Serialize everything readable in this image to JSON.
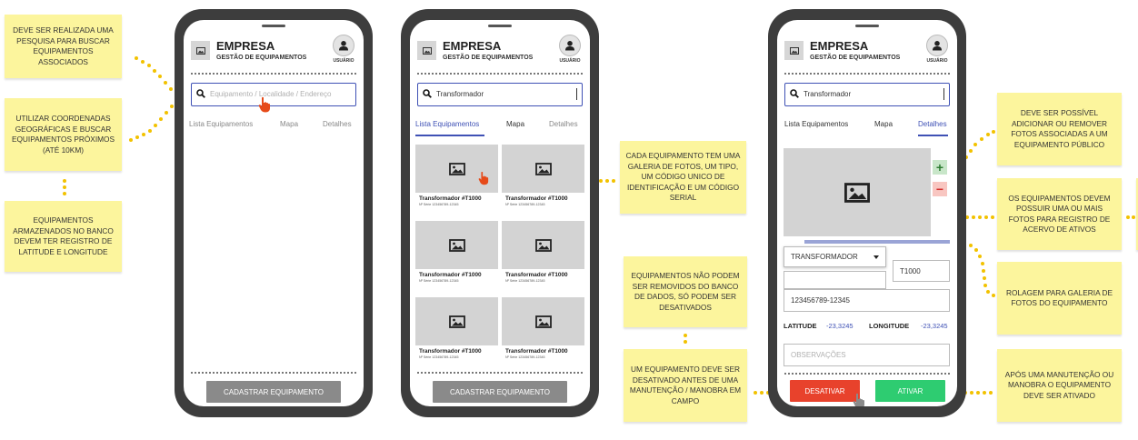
{
  "colors": {
    "note_bg": "#fcf59d",
    "connector": "#f2c200",
    "accent": "#3f51b5",
    "deactivate": "#e8422c",
    "activate": "#2ecc71",
    "cursor": "#e64a19"
  },
  "notes": {
    "n1": "DEVE SER REALIZADA UMA PESQUISA PARA BUSCAR EQUIPAMENTOS ASSOCIADOS",
    "n2": "UTILIZAR COORDENADAS GEOGRÁFICAS E BUSCAR EQUIPAMENTOS PRÓXIMOS (ATÉ 10KM)",
    "n3": "EQUIPAMENTOS ARMAZENADOS NO BANCO DEVEM TER REGISTRO DE LATITUDE E LONGITUDE",
    "n4": "CADA EQUIPAMENTO TEM UMA GALERIA DE FOTOS, UM TIPO, UM CÓDIGO UNICO DE IDENTIFICAÇÃO E UM CÓDIGO SERIAL",
    "n5": "EQUIPAMENTOS NÃO PODEM SER REMOVIDOS DO BANCO DE DADOS, SÓ PODEM SER DESATIVADOS",
    "n6": "UM EQUIPAMENTO DEVE SER DESATIVADO ANTES DE UMA MANUTENÇÃO / MANOBRA EM CAMPO",
    "n7": "DEVE SER POSSÍVEL ADICIONAR OU REMOVER FOTOS ASSOCIADAS A UM EQUIPAMENTO PÚBLICO",
    "n8": "OS EQUIPAMENTOS DEVEM POSSUIR UMA OU MAIS FOTOS PARA REGISTRO DE ACERVO DE ATIVOS",
    "n9": "ROLAGEM PARA GALERIA DE FOTOS DO EQUIPAMENTO",
    "n10": "APÓS UMA MANUTENÇÃO OU MANOBRA O EQUIPAMENTO DEVE SER ATIVADO"
  },
  "header": {
    "brand": "EMPRESA",
    "subtitle": "GESTÃO DE EQUIPAMENTOS",
    "user_label": "USUÁRIO"
  },
  "tabs": {
    "list": "Lista Equipamentos",
    "map": "Mapa",
    "details": "Detalhes"
  },
  "phone1": {
    "search_placeholder": "Equipamento / Localidade / Endereço",
    "register_button": "CADASTRAR EQUIPAMENTO"
  },
  "phone2": {
    "search_value": "Transformador",
    "cards": [
      {
        "title": "Transformador #T1000",
        "serial": "Nº Série 123456789-12345"
      },
      {
        "title": "Transformador #T1000",
        "serial": "Nº Série 123456789-12345"
      },
      {
        "title": "Transformador #T1000",
        "serial": "Nº Série 123456789-12345"
      },
      {
        "title": "Transformador #T1000",
        "serial": "Nº Série 123456789-12345"
      },
      {
        "title": "Transformador #T1000",
        "serial": "Nº Série 123456789-12345"
      },
      {
        "title": "Transformador #T1000",
        "serial": "Nº Série 123456789-12345"
      }
    ],
    "register_button": "CADASTRAR EQUIPAMENTO"
  },
  "phone3": {
    "search_value": "Transformador",
    "add_symbol": "+",
    "remove_symbol": "−",
    "type_select": "TRANSFORMADOR",
    "code_value": "T1000",
    "serial_value": "123456789-12345",
    "latitude_label": "LATITUDE",
    "latitude_value": "-23,3245",
    "longitude_label": "LONGITUDE",
    "longitude_value": "-23,3245",
    "notes_placeholder": "OBSERVAÇÕES",
    "deactivate_button": "DESATIVAR",
    "activate_button": "ATIVAR"
  },
  "icons": {
    "logo": "image-icon",
    "user": "user-icon",
    "search": "search-icon",
    "photo": "image-icon",
    "dropdown": "caret-down-icon",
    "cursor": "hand-pointer-icon"
  }
}
